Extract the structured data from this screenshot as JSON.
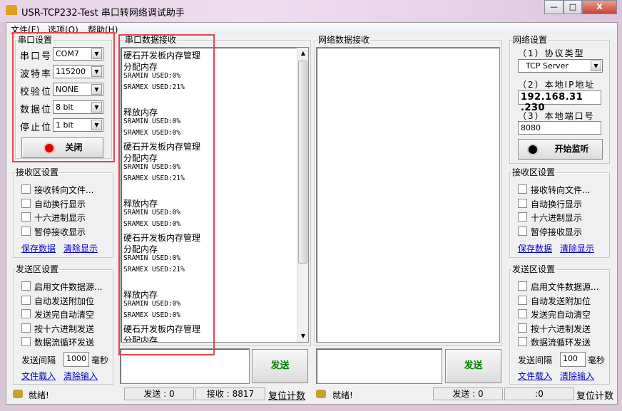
{
  "window": {
    "title": "USR-TCP232-Test 串口转网络调试助手",
    "minimize": "—",
    "maximize": "□",
    "close": "X"
  },
  "menu": [
    "文件(F)",
    "选项(O)",
    "帮助(H)"
  ],
  "serial": {
    "group": "串口设置",
    "rows": [
      {
        "label": "串口号",
        "value": "COM7"
      },
      {
        "label": "波特率",
        "value": "115200"
      },
      {
        "label": "校验位",
        "value": "NONE"
      },
      {
        "label": "数据位",
        "value": "8 bit"
      },
      {
        "label": "停止位",
        "value": "1 bit"
      }
    ],
    "button": "关闭",
    "indicator_color": "#e00000"
  },
  "left_recv": {
    "group": "接收区设置",
    "options": [
      "接收转向文件...",
      "自动换行显示",
      "十六进制显示",
      "暂停接收显示"
    ],
    "link1": "保存数据",
    "link2": "清除显示"
  },
  "left_send": {
    "group": "发送区设置",
    "options": [
      "启用文件数据源...",
      "自动发送附加位",
      "发送完自动清空",
      "按十六进制发送",
      "数据流循环发送"
    ],
    "interval_label": "发送间隔",
    "interval": "1000",
    "unit": "毫秒",
    "link1": "文件载入",
    "link2": "清除输入"
  },
  "serial_recv": {
    "group": "串口数据接收",
    "lines": [
      "硬石开发板内存管理",
      "分配内存",
      "SRAMIN USED:0%",
      "SRAMEX USED:21%",
      "",
      "释放内存",
      "SRAMIN USED:0%",
      "SRAMEX USED:0%",
      "硬石开发板内存管理",
      "分配内存",
      "SRAMIN USED:0%",
      "SRAMEX USED:21%",
      "",
      "释放内存",
      "SRAMIN USED:0%",
      "SRAMEX USED:0%",
      "硬石开发板内存管理",
      "分配内存",
      "SRAMIN USED:0%",
      "SRAMEX USED:21%",
      "",
      "释放内存",
      "SRAMIN USED:0%",
      "SRAMEX USED:0%",
      "硬石开发板内存管理",
      "分配内存"
    ],
    "send_button": "发送"
  },
  "net_recv": {
    "group": "网络数据接收",
    "send_button": "发送"
  },
  "net": {
    "group": "网络设置",
    "protocol_label": "（1）协议类型",
    "protocol": "TCP Server",
    "ip_label": "（2）本地IP地址",
    "ip": "192.168.31 .230",
    "port_label": "（3）本地端口号",
    "port": "8080",
    "button": "开始监听"
  },
  "right_recv": {
    "group": "接收区设置",
    "options": [
      "接收转向文件...",
      "自动换行显示",
      "十六进制显示",
      "暂停接收显示"
    ],
    "link1": "保存数据",
    "link2": "清除显示"
  },
  "right_send": {
    "group": "发送区设置",
    "options": [
      "启用文件数据源...",
      "自动发送附加位",
      "发送完自动清空",
      "按十六进制发送",
      "数据流循环发送"
    ],
    "interval_label": "发送间隔",
    "interval": "100",
    "unit": "毫秒",
    "link1": "文件载入",
    "link2": "清除输入"
  },
  "status_left": {
    "ready": "就绪!",
    "sent": "发送 : 0",
    "recv": "接收 : 8817",
    "reset": "复位计数"
  },
  "status_right": {
    "ready": "就绪!",
    "sent": "发送 : 0",
    "recv": ":0",
    "reset": "复位计数"
  },
  "colors": {
    "send_text": "#008000",
    "link": "#0000cc",
    "highlight": "#e0484a"
  }
}
